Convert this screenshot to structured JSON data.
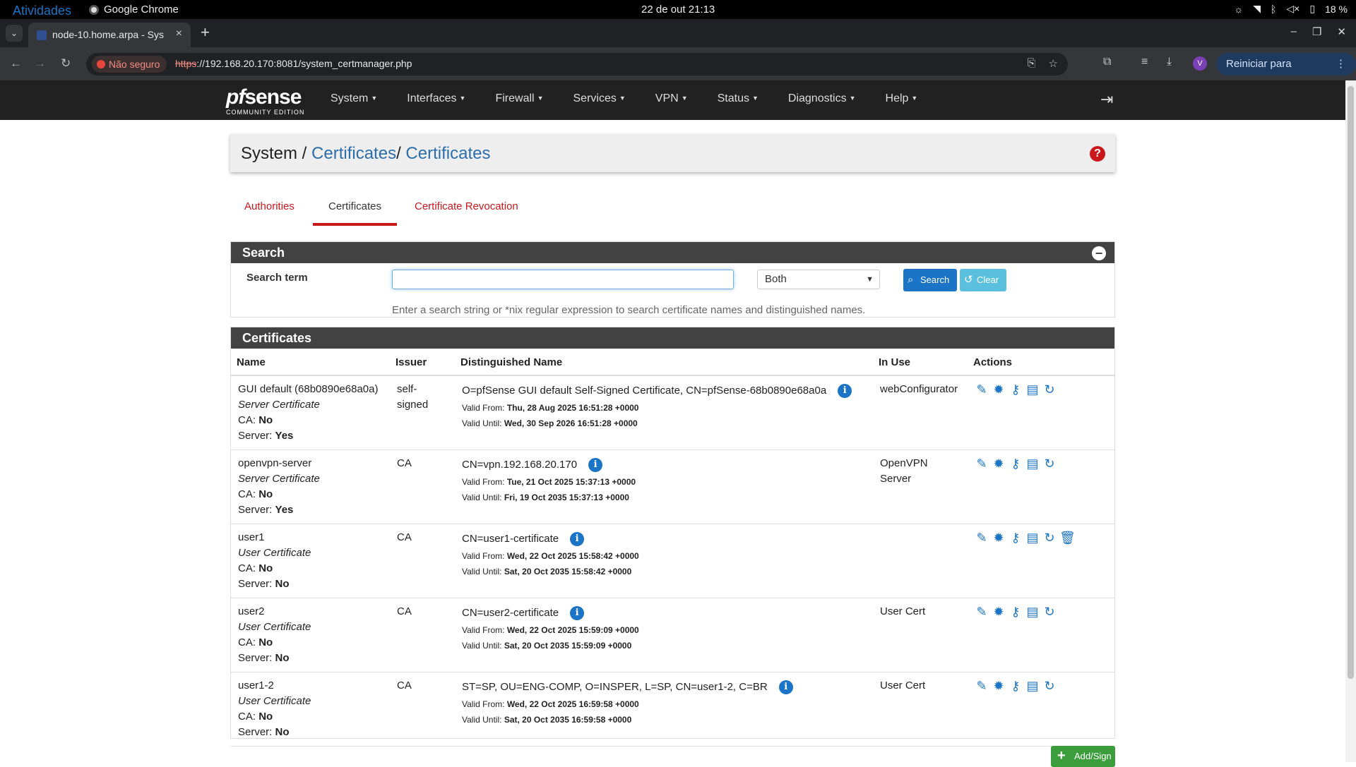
{
  "gnome": {
    "activities": "Atividades",
    "app": "Google Chrome",
    "clock": "22 de out  21:13",
    "battery": "18 %"
  },
  "browser": {
    "tab_title": "node-10.home.arpa - Sys",
    "security": "Não seguro",
    "url_scheme": "https",
    "url_rest": "://192.168.20.170:8081/system_certmanager.php",
    "avatar": "V",
    "update_label": "Reiniciar para atualizar"
  },
  "nav": {
    "logo_main": "sense",
    "logo_pf": "pf",
    "logo_sub": "COMMUNITY EDITION",
    "menu": [
      "System",
      "Interfaces",
      "Firewall",
      "Services",
      "VPN",
      "Status",
      "Diagnostics",
      "Help"
    ]
  },
  "breadcrumb": {
    "root": "System /",
    "mid": "Certificates",
    "sep": "/",
    "current": "Certificates"
  },
  "tabs": [
    "Authorities",
    "Certificates",
    "Certificate Revocation"
  ],
  "search": {
    "title": "Search",
    "label": "Search term",
    "value": "",
    "select": "Both",
    "search_btn": "Search",
    "clear_btn": "Clear",
    "hint": "Enter a search string or *nix regular expression to search certificate names and distinguished names."
  },
  "certs": {
    "title": "Certificates",
    "columns": [
      "Name",
      "Issuer",
      "Distinguished Name",
      "In Use",
      "Actions"
    ],
    "ca_label": "CA:",
    "server_label": "Server:",
    "from_label": "Valid From:",
    "until_label": "Valid Until:",
    "rows": [
      {
        "name": "GUI default (68b0890e68a0a)",
        "type": "Server Certificate",
        "ca": "No",
        "server": "Yes",
        "issuer": "self-signed",
        "dn": "O=pfSense GUI default Self-Signed Certificate, CN=pfSense-68b0890e68a0a",
        "from": "Thu, 28 Aug 2025 16:51:28 +0000",
        "until": "Wed, 30 Sep 2026 16:51:28 +0000",
        "inuse": "webConfigurator"
      },
      {
        "name": "openvpn-server",
        "type": "Server Certificate",
        "ca": "No",
        "server": "Yes",
        "issuer": "CA",
        "dn": "CN=vpn.192.168.20.170",
        "from": "Tue, 21 Oct 2025 15:37:13 +0000",
        "until": "Fri, 19 Oct 2035 15:37:13 +0000",
        "inuse": "OpenVPN Server"
      },
      {
        "name": "user1",
        "type": "User Certificate",
        "ca": "No",
        "server": "No",
        "issuer": "CA",
        "dn": "CN=user1-certificate",
        "from": "Wed, 22 Oct 2025 15:58:42 +0000",
        "until": "Sat, 20 Oct 2035 15:58:42 +0000",
        "inuse": ""
      },
      {
        "name": "user2",
        "type": "User Certificate",
        "ca": "No",
        "server": "No",
        "issuer": "CA",
        "dn": "CN=user2-certificate",
        "from": "Wed, 22 Oct 2025 15:59:09 +0000",
        "until": "Sat, 20 Oct 2035 15:59:09 +0000",
        "inuse": "User Cert"
      },
      {
        "name": "user1-2",
        "type": "User Certificate",
        "ca": "No",
        "server": "No",
        "issuer": "CA",
        "dn": "ST=SP, OU=ENG-COMP, O=INSPER, L=SP, CN=user1-2, C=BR",
        "from": "Wed, 22 Oct 2025 16:59:58 +0000",
        "until": "Sat, 20 Oct 2035 16:59:58 +0000",
        "inuse": "User Cert"
      }
    ]
  },
  "add_btn": "Add/Sign"
}
